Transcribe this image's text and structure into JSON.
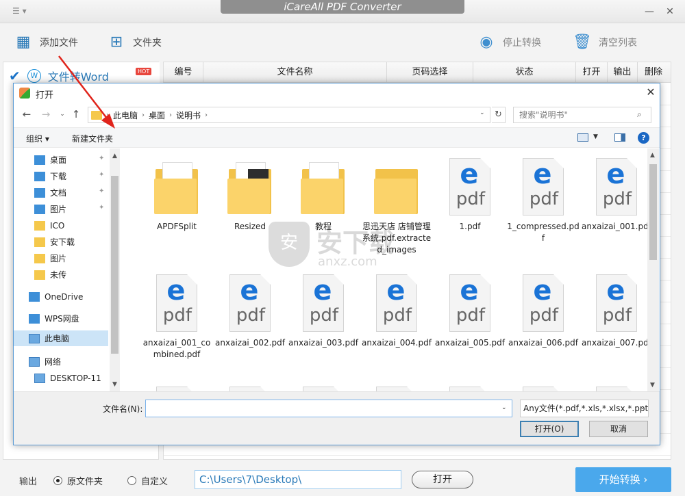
{
  "app": {
    "title": "iCareAll PDF Converter",
    "menu_icon": "☰ ▾",
    "minimize": "—",
    "close": "✕"
  },
  "toolbar": {
    "add_file": "添加文件",
    "add_folder": "文件夹",
    "stop": "停止转换",
    "clear": "清空列表"
  },
  "left_panel": {
    "active_item": "文件转Word",
    "hot_badge": "HOT"
  },
  "grid": {
    "columns": [
      "编号",
      "文件名称",
      "页码选择",
      "状态",
      "打开",
      "输出",
      "删除"
    ]
  },
  "bottom": {
    "output_label": "输出",
    "radio_source": "原文件夹",
    "radio_custom": "自定义",
    "path": "C:\\Users\\7\\Desktop\\",
    "open_button": "打开",
    "start_button": "开始转换  ›"
  },
  "dialog": {
    "title": "打开",
    "breadcrumb": [
      "此电脑",
      "桌面",
      "说明书"
    ],
    "search_placeholder": "搜索\"说明书\"",
    "organize": "组织 ▾",
    "new_folder": "新建文件夹",
    "nav_items": [
      {
        "label": "桌面",
        "icon": "desktop-icon",
        "pinned": true
      },
      {
        "label": "下载",
        "icon": "download-icon",
        "pinned": true
      },
      {
        "label": "文档",
        "icon": "document-icon",
        "pinned": true
      },
      {
        "label": "图片",
        "icon": "picture-icon",
        "pinned": true
      },
      {
        "label": "ICO",
        "icon": "folder-icon",
        "pinned": false
      },
      {
        "label": "安下载",
        "icon": "folder-icon",
        "pinned": false
      },
      {
        "label": "图片",
        "icon": "folder-icon",
        "pinned": false
      },
      {
        "label": "未传",
        "icon": "folder-icon",
        "pinned": false
      },
      {
        "label": "OneDrive",
        "icon": "cloud-icon",
        "pinned": false
      },
      {
        "label": "WPS网盘",
        "icon": "cloud-icon",
        "pinned": false
      },
      {
        "label": "此电脑",
        "icon": "computer-icon",
        "pinned": false
      },
      {
        "label": "网络",
        "icon": "network-icon",
        "pinned": false
      },
      {
        "label": "DESKTOP-11",
        "icon": "computer-icon",
        "pinned": false
      }
    ],
    "files_row1": [
      "APDFSplit",
      "Resized",
      "教程",
      "思迅天店 店铺管理系统.pdf.extracted_images",
      "1.pdf",
      "1_compressed.pdf",
      "anxaizai_001.pdf"
    ],
    "files_row2": [
      "anxaizai_001_combined.pdf",
      "anxaizai_002.pdf",
      "anxaizai_003.pdf",
      "anxaizai_004.pdf",
      "anxaizai_005.pdf",
      "anxaizai_006.pdf",
      "anxaizai_007.pdf"
    ],
    "pdf_icon_letter": "e",
    "pdf_icon_text": "pdf",
    "filename_label": "文件名(N):",
    "filename_value": "",
    "filetype": "Any文件(*.pdf,*.xls,*.xlsx,*.ppt",
    "open_button": "打开(O)",
    "cancel_button": "取消"
  },
  "watermark": {
    "shield": "安",
    "text": "安下载",
    "site": "anxz.com"
  },
  "colors": {
    "accent": "#2a7ab8",
    "start_button": "#4aa8ec",
    "arrow": "#e0241b"
  }
}
